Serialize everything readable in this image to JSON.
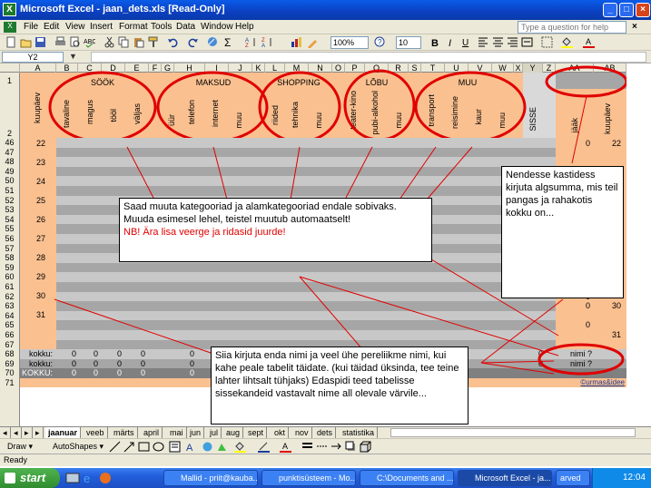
{
  "window": {
    "title": "Microsoft Excel - jaan_dets.xls  [Read-Only]",
    "app_icon": "excel-icon"
  },
  "menu": [
    "File",
    "Edit",
    "View",
    "Insert",
    "Format",
    "Tools",
    "Data",
    "Window",
    "Help"
  ],
  "help_placeholder": "Type a question for help",
  "toolbar": {
    "zoom": "100%",
    "font_size": "10"
  },
  "namebox": "Y2",
  "columns": [
    "A",
    "B",
    "C",
    "D",
    "E",
    "F",
    "G",
    "H",
    "I",
    "J",
    "K",
    "L",
    "M",
    "N",
    "O",
    "P",
    "Q",
    "R",
    "S",
    "T",
    "U",
    "V",
    "W",
    "X",
    "Y",
    "Z",
    "AA",
    "AB"
  ],
  "header": {
    "kuupaev": "kuupäev",
    "categories": {
      "sook": "SÖÖK",
      "maksud": "MAKSUD",
      "shopping": "SHOPPING",
      "lobu": "LÕBU",
      "muu": "MUU"
    },
    "sub": {
      "sook": [
        "tavaline",
        "magus",
        "tööl",
        "väljas"
      ],
      "maksud": [
        "üür",
        "telefon",
        "internet",
        "muu"
      ],
      "shopping": [
        "riided",
        "tehnika",
        "muu"
      ],
      "lobu": [
        "teater-kino",
        "pubi-alkohol",
        "muu"
      ],
      "muu": [
        "transport",
        "reisimine",
        "kaur",
        "muu"
      ]
    },
    "sisse": "SISSE",
    "jaak": "jääk",
    "kuupaev2": "kuupäev"
  },
  "row_numbers": [
    "1",
    "2",
    "46",
    "47",
    "48",
    "49",
    "50",
    "51",
    "52",
    "53",
    "54",
    "55",
    "56",
    "57",
    "58",
    "59",
    "60",
    "61",
    "62",
    "63",
    "64",
    "65",
    "66",
    "67",
    "68",
    "69",
    "70",
    "71"
  ],
  "day_labels": {
    "46": "22",
    "48": "23",
    "50": "24",
    "52": "25",
    "54": "26",
    "56": "27",
    "58": "28",
    "60": "29",
    "62": "30",
    "64": "31"
  },
  "right_values": {
    "jaak_zeros": [
      "0",
      "0",
      "0",
      "0"
    ],
    "days_right": [
      "22",
      "30",
      "31"
    ]
  },
  "totals": {
    "kokku1": "kokku:",
    "kokku2": "kokku:",
    "kokku3": "KOKKU:",
    "nimi1": "nimi ?",
    "nimi2": "nimi ?",
    "zero": "0",
    "link": "©urmas&idee"
  },
  "callouts": {
    "categories": "Saad muuta kategooriad ja alamkategooriad endale sobivaks. Muuda esimesel lehel, teistel muutub automaatselt!",
    "warning": "NB! Ära lisa veerge ja ridasid juurde!",
    "start_sum": "Nendesse kastidess kirjuta algsumma, mis teil pangas ja rahakotis kokku on...",
    "name": "Siia kirjuta enda nimi ja veel ühe pereliikme nimi, kui kahe peale tabelit täidate.  (kui täidad üksinda, tee teine lahter lihtsalt tühjaks) Edaspidi teed tabelisse sissekandeid vastavalt nime all olevale värvile..."
  },
  "sheets": [
    "jaanuar",
    "veeb",
    "märts",
    "april",
    "mai",
    "jun",
    "jul",
    "aug",
    "sept",
    "okt",
    "nov",
    "dets",
    "statistika"
  ],
  "drawbar": {
    "draw": "Draw ▾",
    "autoshapes": "AutoShapes ▾"
  },
  "status": "Ready",
  "taskbar": {
    "start": "start",
    "tasks": [
      "Mallid - priit@kauba...",
      "punktisüsteem - Mo...",
      "C:\\Documents and ...",
      "Microsoft Excel - ja..."
    ],
    "extra": "arved",
    "time": "12:04"
  },
  "colors": {
    "header_orange": "#fac090",
    "row_dark": "#a6a6a6",
    "row_light": "#c8c8c8",
    "annotation_red": "#e00000"
  }
}
